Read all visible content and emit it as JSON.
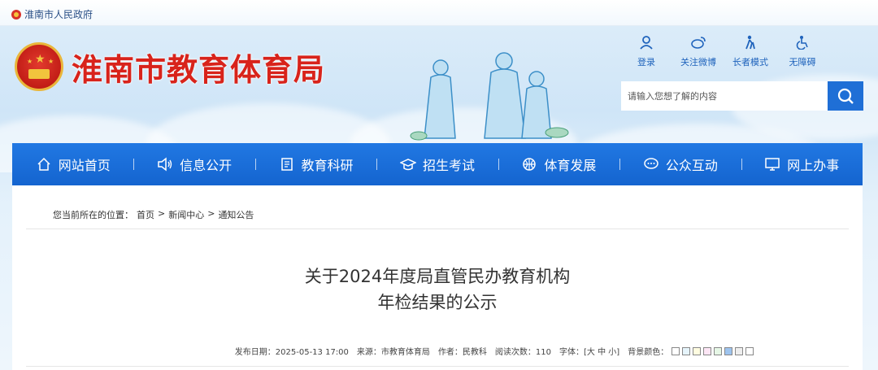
{
  "topbar": {
    "gov_link": "淮南市人民政府"
  },
  "header": {
    "site_title": "淮南市教育体育局"
  },
  "tools": [
    {
      "label": "登录",
      "icon": "user-icon"
    },
    {
      "label": "关注微博",
      "icon": "weibo-icon"
    },
    {
      "label": "长者模式",
      "icon": "elder-icon"
    },
    {
      "label": "无障碍",
      "icon": "accessibility-icon"
    }
  ],
  "search": {
    "placeholder": "请输入您想了解的内容"
  },
  "nav": [
    {
      "label": "网站首页",
      "icon": "home-icon"
    },
    {
      "label": "信息公开",
      "icon": "speaker-icon"
    },
    {
      "label": "教育科研",
      "icon": "document-icon"
    },
    {
      "label": "招生考试",
      "icon": "graduation-cap-icon"
    },
    {
      "label": "体育发展",
      "icon": "basketball-icon"
    },
    {
      "label": "公众互动",
      "icon": "chat-bubble-icon"
    },
    {
      "label": "网上办事",
      "icon": "monitor-icon"
    }
  ],
  "breadcrumb": {
    "prefix": "您当前所在的位置：",
    "items": [
      "首页",
      "新闻中心",
      "通知公告"
    ],
    "separator": ">"
  },
  "article": {
    "title_line1": "关于2024年度局直管民办教育机构",
    "title_line2": "年检结果的公示",
    "publish_date": "发布日期：2025-05-13 17:00",
    "source": "来源：市教育体育局",
    "author": "作者：民教科",
    "views": "阅读次数：110",
    "font_label": "字体：[",
    "font_large": "大",
    "font_medium": "中",
    "font_small": "小",
    "font_close": "]",
    "bg_label": "背景颜色："
  },
  "colors": {
    "brand_red": "#d8231b",
    "nav_blue": "#1a6cd9",
    "swatches": [
      "#ffffff",
      "#e6f4fb",
      "#fffce0",
      "#fde6f5",
      "#e6f7e6",
      "#9ec4ee",
      "#eeeeee",
      "#ffffff"
    ]
  }
}
